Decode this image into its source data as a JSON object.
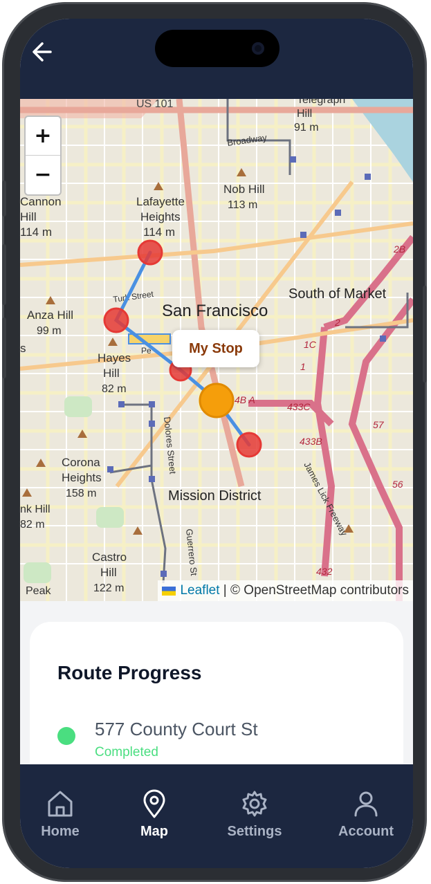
{
  "header": {
    "back_icon": "arrow-left-icon"
  },
  "map": {
    "zoom_in": "+",
    "zoom_out": "−",
    "popup": "My Stop",
    "attribution": {
      "leaflet": "Leaflet",
      "separator": " | ",
      "osm": "© OpenStreetMap contributors"
    },
    "labels": {
      "us101": "US 101",
      "telegraph": "Telegraph",
      "hill": "Hill",
      "hill_elev": "91 m",
      "broadway": "Broadway",
      "nob_hill": "Nob Hill",
      "nob_elev": "113 m",
      "cannon": "Cannon",
      "cannon_hill": "Hill",
      "cannon_elev": "114 m",
      "lafayette": "Lafayette",
      "heights": "Heights",
      "lafayette_elev": "114 m",
      "turk": "Turk Street",
      "sf": "San Francisco",
      "som": "South of Market",
      "anza": "Anza Hill",
      "anza_elev": "99 m",
      "hayes": "Hayes",
      "hayes_hill": "Hill",
      "hayes_elev": "82 m",
      "corona": "Corona",
      "corona_heights": "Heights",
      "corona_elev": "158 m",
      "mission": "Mission District",
      "dolores": "Dolores Street",
      "guerrero": "Guerrero St",
      "nk_hill": "nk Hill",
      "nk_elev": "82 m",
      "castro": "Castro",
      "castro_hill": "Hill",
      "castro_elev": "122 m",
      "peak": "Peak",
      "james_lick": "James Lick Freeway",
      "r2b": "2B",
      "r2": "2",
      "r1c": "1C",
      "r1": "1",
      "r433c": "433C",
      "r433b": "433B",
      "r432": "432",
      "r57": "57",
      "r56": "56",
      "r4ba": "4B A",
      "s1": "s",
      "pe": "Pe"
    }
  },
  "route_progress": {
    "title": "Route Progress",
    "stops": [
      {
        "name": "577 County Court St",
        "status": "Completed",
        "status_color": "#4ade80"
      }
    ]
  },
  "nav": {
    "items": [
      {
        "label": "Home",
        "icon": "home-icon",
        "active": false
      },
      {
        "label": "Map",
        "icon": "map-pin-icon",
        "active": true
      },
      {
        "label": "Settings",
        "icon": "gear-icon",
        "active": false
      },
      {
        "label": "Account",
        "icon": "user-icon",
        "active": false
      }
    ]
  },
  "colors": {
    "bar": "#1c2740",
    "route_line": "#4a90e2",
    "stop_marker": "#e53935",
    "my_stop_marker": "#f59e0b"
  }
}
